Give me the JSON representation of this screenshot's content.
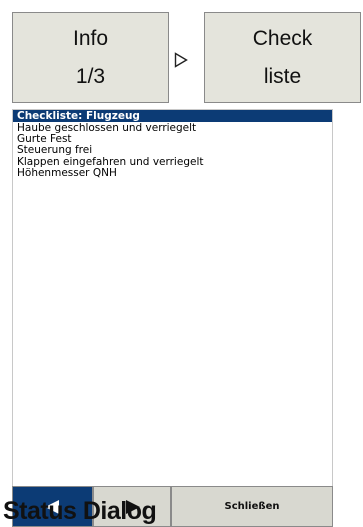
{
  "header": {
    "info_tile": {
      "line1": "Info",
      "line2": "1/3"
    },
    "checklist_tile": {
      "line1": "Check",
      "line2": "liste"
    },
    "arrow_icon": "triangle-right-outline"
  },
  "checklist": {
    "title": "Checkliste: Flugzeug",
    "items": [
      "Haube geschlossen und verriegelt",
      "Gurte Fest",
      "Steuerung frei",
      "Klappen eingefahren und verriegelt",
      "Höhenmesser QNH"
    ]
  },
  "footer": {
    "close_label": "Schließen",
    "prev_icon": "arrow-left-icon",
    "next_icon": "arrow-right-icon",
    "status_label": "Status Dialog"
  },
  "colors": {
    "title_bar": "#0c3b75",
    "tile_bg": "#e4e4dc",
    "active_button": "#0c3b75"
  }
}
